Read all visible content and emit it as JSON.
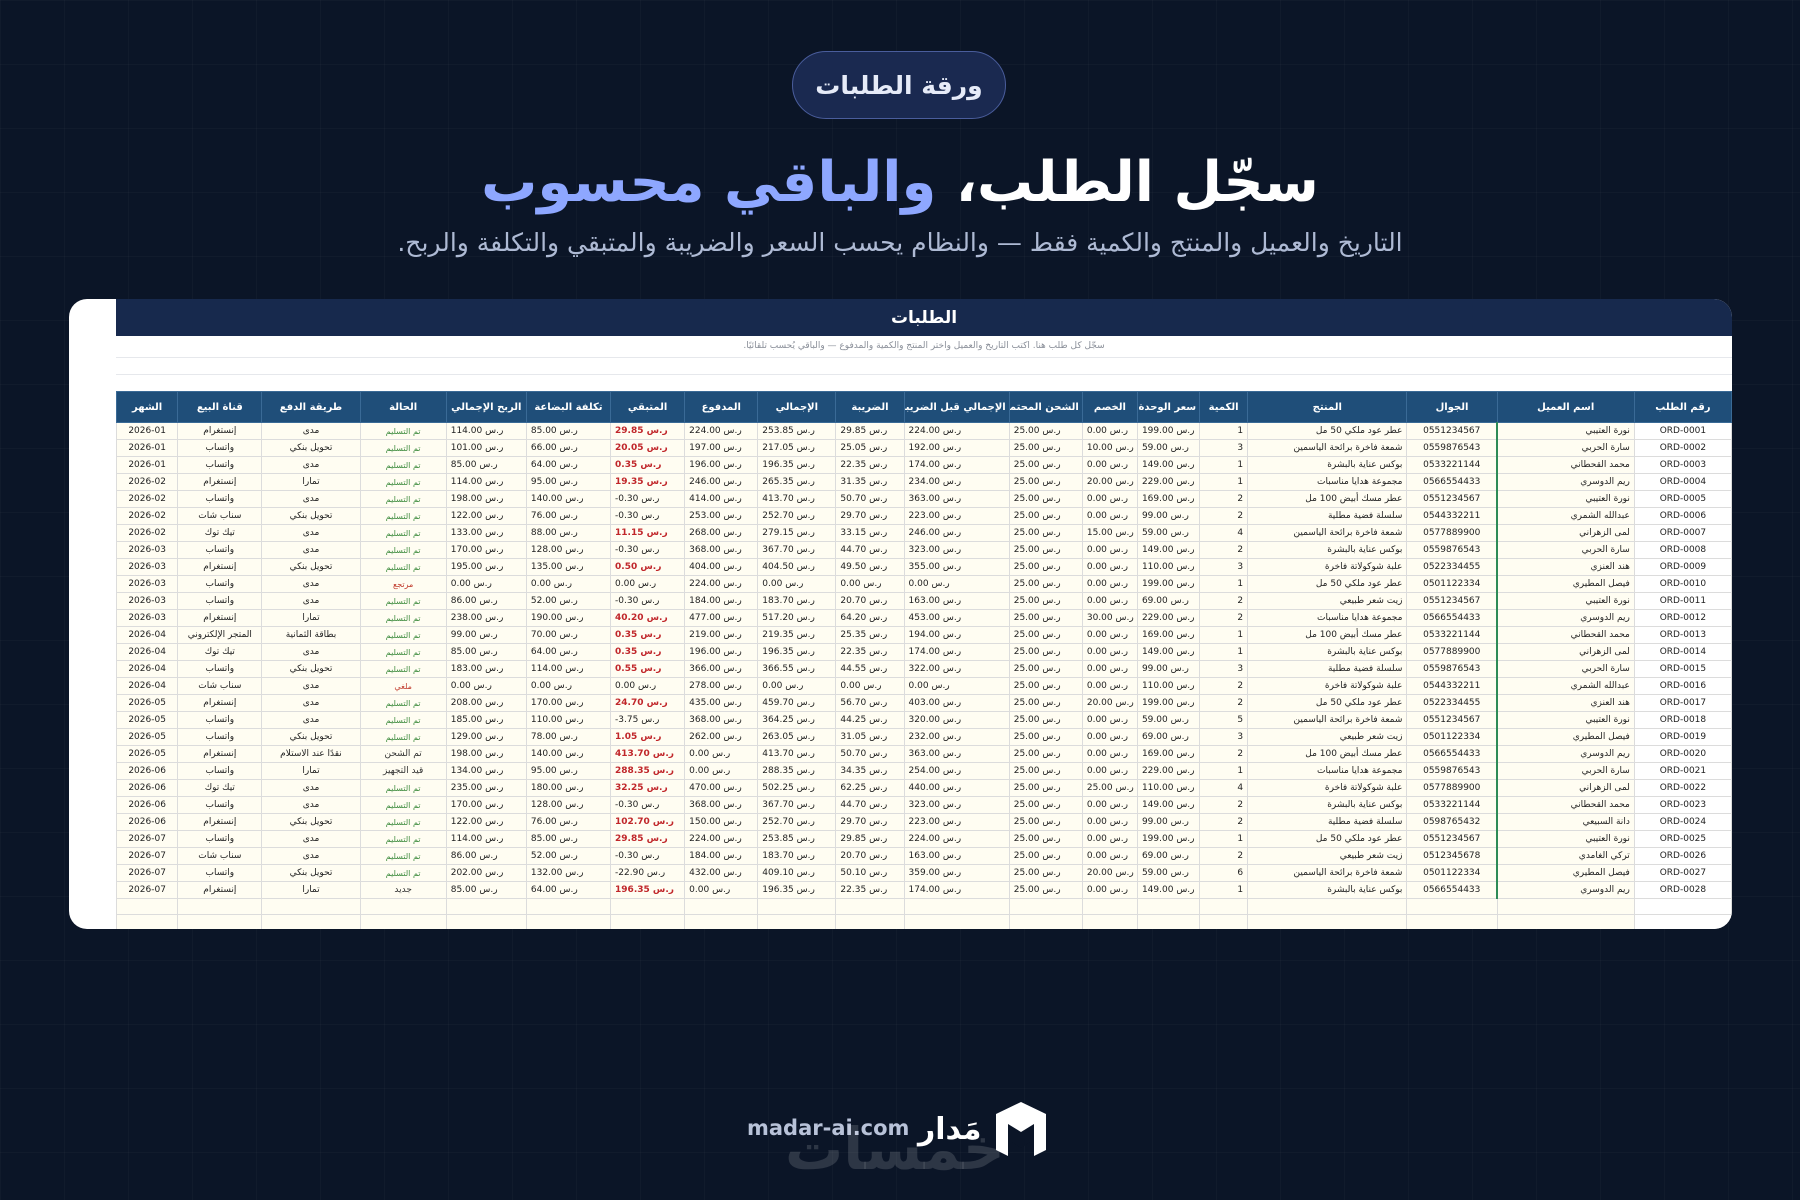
{
  "pill_label": "ورقة الطلبات",
  "headline": {
    "part1": "سجّل الطلب،",
    "accent": "والباقي محسوب"
  },
  "subtitle": "التاريخ والعميل والمنتج والكمية فقط — والنظام يحسب السعر والضريبة والمتبقي والتكلفة والربح.",
  "sheet": {
    "title": "الطلبات",
    "note": "سجّل كل طلب هنا. اكتب التاريخ والعميل واختر المنتج والكمية والمدفوع — والباقي يُحسب تلقائيًا.",
    "columns": [
      "رقم الطلب",
      "اسم العميل",
      "الجوال",
      "المنتج",
      "الكمية",
      "سعر الوحدة",
      "الخصم",
      "الشحن المحتمل",
      "الإجمالي قبل الضريبة",
      "الضريبة",
      "الإجمالي",
      "المدفوع",
      "المتبقي",
      "تكلفة البضاعة",
      "الربح الإجمالي",
      "الحالة",
      "طريقة الدفع",
      "قناة البيع",
      "الشهر"
    ],
    "rows": [
      [
        "ORD-0001",
        "نورة العتيبي",
        "0551234567",
        "عطر عود ملكي 50 مل",
        "1",
        "199.00 ر.س",
        "0.00 ر.س",
        "25.00 ر.س",
        "224.00 ر.س",
        "29.85 ر.س",
        "253.85 ر.س",
        "224.00 ر.س",
        "29.85 ر.س",
        "85.00 ر.س",
        "114.00 ر.س",
        "تم التسليم",
        "مدى",
        "إنستغرام",
        "2026-01"
      ],
      [
        "ORD-0002",
        "سارة الحربي",
        "0559876543",
        "شمعة فاخرة برائحة الياسمين",
        "3",
        "59.00 ر.س",
        "10.00 ر.س",
        "25.00 ر.س",
        "192.00 ر.س",
        "25.05 ر.س",
        "217.05 ر.س",
        "197.00 ر.س",
        "20.05 ر.س",
        "66.00 ر.س",
        "101.00 ر.س",
        "تم التسليم",
        "تحويل بنكي",
        "واتساب",
        "2026-01"
      ],
      [
        "ORD-0003",
        "محمد القحطاني",
        "0533221144",
        "بوكس عناية بالبشرة",
        "1",
        "149.00 ر.س",
        "0.00 ر.س",
        "25.00 ر.س",
        "174.00 ر.س",
        "22.35 ر.س",
        "196.35 ر.س",
        "196.00 ر.س",
        "0.35 ر.س",
        "64.00 ر.س",
        "85.00 ر.س",
        "تم التسليم",
        "مدى",
        "واتساب",
        "2026-01"
      ],
      [
        "ORD-0004",
        "ريم الدوسري",
        "0566554433",
        "مجموعة هدايا مناسبات",
        "1",
        "229.00 ر.س",
        "20.00 ر.س",
        "25.00 ر.س",
        "234.00 ر.س",
        "31.35 ر.س",
        "265.35 ر.س",
        "246.00 ر.س",
        "19.35 ر.س",
        "95.00 ر.س",
        "114.00 ر.س",
        "تم التسليم",
        "تمارا",
        "إنستغرام",
        "2026-02"
      ],
      [
        "ORD-0005",
        "نورة العتيبي",
        "0551234567",
        "عطر مسك أبيض 100 مل",
        "2",
        "169.00 ر.س",
        "0.00 ر.س",
        "25.00 ر.س",
        "363.00 ر.س",
        "50.70 ر.س",
        "413.70 ر.س",
        "414.00 ر.س",
        "-0.30 ر.س",
        "140.00 ر.س",
        "198.00 ر.س",
        "تم التسليم",
        "مدى",
        "واتساب",
        "2026-02"
      ],
      [
        "ORD-0006",
        "عبدالله الشمري",
        "0544332211",
        "سلسلة فضية مطلية",
        "2",
        "99.00 ر.س",
        "0.00 ر.س",
        "25.00 ر.س",
        "223.00 ر.س",
        "29.70 ر.س",
        "252.70 ر.س",
        "253.00 ر.س",
        "-0.30 ر.س",
        "76.00 ر.س",
        "122.00 ر.س",
        "تم التسليم",
        "تحويل بنكي",
        "سناب شات",
        "2026-02"
      ],
      [
        "ORD-0007",
        "لمى الزهراني",
        "0577889900",
        "شمعة فاخرة برائحة الياسمين",
        "4",
        "59.00 ر.س",
        "15.00 ر.س",
        "25.00 ر.س",
        "246.00 ر.س",
        "33.15 ر.س",
        "279.15 ر.س",
        "268.00 ر.س",
        "11.15 ر.س",
        "88.00 ر.س",
        "133.00 ر.س",
        "تم التسليم",
        "مدى",
        "تيك توك",
        "2026-02"
      ],
      [
        "ORD-0008",
        "سارة الحربي",
        "0559876543",
        "بوكس عناية بالبشرة",
        "2",
        "149.00 ر.س",
        "0.00 ر.س",
        "25.00 ر.س",
        "323.00 ر.س",
        "44.70 ر.س",
        "367.70 ر.س",
        "368.00 ر.س",
        "-0.30 ر.س",
        "128.00 ر.س",
        "170.00 ر.س",
        "تم التسليم",
        "مدى",
        "واتساب",
        "2026-03"
      ],
      [
        "ORD-0009",
        "هند العنزي",
        "0522334455",
        "علبة شوكولاتة فاخرة",
        "3",
        "110.00 ر.س",
        "0.00 ر.س",
        "25.00 ر.س",
        "355.00 ر.س",
        "49.50 ر.س",
        "404.50 ر.س",
        "404.00 ر.س",
        "0.50 ر.س",
        "135.00 ر.س",
        "195.00 ر.س",
        "تم التسليم",
        "تحويل بنكي",
        "إنستغرام",
        "2026-03"
      ],
      [
        "ORD-0010",
        "فيصل المطيري",
        "0501122334",
        "عطر عود ملكي 50 مل",
        "1",
        "199.00 ر.س",
        "0.00 ر.س",
        "25.00 ر.س",
        "0.00 ر.س",
        "0.00 ر.س",
        "0.00 ر.س",
        "224.00 ر.س",
        "0.00 ر.س",
        "0.00 ر.س",
        "0.00 ر.س",
        "مرتجع",
        "مدى",
        "واتساب",
        "2026-03"
      ],
      [
        "ORD-0011",
        "نورة العتيبي",
        "0551234567",
        "زيت شعر طبيعي",
        "2",
        "69.00 ر.س",
        "0.00 ر.س",
        "25.00 ر.س",
        "163.00 ر.س",
        "20.70 ر.س",
        "183.70 ر.س",
        "184.00 ر.س",
        "-0.30 ر.س",
        "52.00 ر.س",
        "86.00 ر.س",
        "تم التسليم",
        "مدى",
        "واتساب",
        "2026-03"
      ],
      [
        "ORD-0012",
        "ريم الدوسري",
        "0566554433",
        "مجموعة هدايا مناسبات",
        "2",
        "229.00 ر.س",
        "30.00 ر.س",
        "25.00 ر.س",
        "453.00 ر.س",
        "64.20 ر.س",
        "517.20 ر.س",
        "477.00 ر.س",
        "40.20 ر.س",
        "190.00 ر.س",
        "238.00 ر.س",
        "تم التسليم",
        "تمارا",
        "إنستغرام",
        "2026-03"
      ],
      [
        "ORD-0013",
        "محمد القحطاني",
        "0533221144",
        "عطر مسك أبيض 100 مل",
        "1",
        "169.00 ر.س",
        "0.00 ر.س",
        "25.00 ر.س",
        "194.00 ر.س",
        "25.35 ر.س",
        "219.35 ر.س",
        "219.00 ر.س",
        "0.35 ر.س",
        "70.00 ر.س",
        "99.00 ر.س",
        "تم التسليم",
        "بطاقة الثمانية",
        "المتجر الإلكتروني",
        "2026-04"
      ],
      [
        "ORD-0014",
        "لمى الزهراني",
        "0577889900",
        "بوكس عناية بالبشرة",
        "1",
        "149.00 ر.س",
        "0.00 ر.س",
        "25.00 ر.س",
        "174.00 ر.س",
        "22.35 ر.س",
        "196.35 ر.س",
        "196.00 ر.س",
        "0.35 ر.س",
        "64.00 ر.س",
        "85.00 ر.س",
        "تم التسليم",
        "مدى",
        "تيك توك",
        "2026-04"
      ],
      [
        "ORD-0015",
        "سارة الحربي",
        "0559876543",
        "سلسلة فضية مطلية",
        "3",
        "99.00 ر.س",
        "0.00 ر.س",
        "25.00 ر.س",
        "322.00 ر.س",
        "44.55 ر.س",
        "366.55 ر.س",
        "366.00 ر.س",
        "0.55 ر.س",
        "114.00 ر.س",
        "183.00 ر.س",
        "تم التسليم",
        "تحويل بنكي",
        "واتساب",
        "2026-04"
      ],
      [
        "ORD-0016",
        "عبدالله الشمري",
        "0544332211",
        "علبة شوكولاتة فاخرة",
        "2",
        "110.00 ر.س",
        "0.00 ر.س",
        "25.00 ر.س",
        "0.00 ر.س",
        "0.00 ر.س",
        "0.00 ر.س",
        "278.00 ر.س",
        "0.00 ر.س",
        "0.00 ر.س",
        "0.00 ر.س",
        "ملغي",
        "مدى",
        "سناب شات",
        "2026-04"
      ],
      [
        "ORD-0017",
        "هند العنزي",
        "0522334455",
        "عطر عود ملكي 50 مل",
        "2",
        "199.00 ر.س",
        "20.00 ر.س",
        "25.00 ر.س",
        "403.00 ر.س",
        "56.70 ر.س",
        "459.70 ر.س",
        "435.00 ر.س",
        "24.70 ر.س",
        "170.00 ر.س",
        "208.00 ر.س",
        "تم التسليم",
        "مدى",
        "إنستغرام",
        "2026-05"
      ],
      [
        "ORD-0018",
        "نورة العتيبي",
        "0551234567",
        "شمعة فاخرة برائحة الياسمين",
        "5",
        "59.00 ر.س",
        "0.00 ر.س",
        "25.00 ر.س",
        "320.00 ر.س",
        "44.25 ر.س",
        "364.25 ر.س",
        "368.00 ر.س",
        "-3.75 ر.س",
        "110.00 ر.س",
        "185.00 ر.س",
        "تم التسليم",
        "مدى",
        "واتساب",
        "2026-05"
      ],
      [
        "ORD-0019",
        "فيصل المطيري",
        "0501122334",
        "زيت شعر طبيعي",
        "3",
        "69.00 ر.س",
        "0.00 ر.س",
        "25.00 ر.س",
        "232.00 ر.س",
        "31.05 ر.س",
        "263.05 ر.س",
        "262.00 ر.س",
        "1.05 ر.س",
        "78.00 ر.س",
        "129.00 ر.س",
        "تم التسليم",
        "تحويل بنكي",
        "واتساب",
        "2026-05"
      ],
      [
        "ORD-0020",
        "ريم الدوسري",
        "0566554433",
        "عطر مسك أبيض 100 مل",
        "2",
        "169.00 ر.س",
        "0.00 ر.س",
        "25.00 ر.س",
        "363.00 ر.س",
        "50.70 ر.س",
        "413.70 ر.س",
        "0.00 ر.س",
        "413.70 ر.س",
        "140.00 ر.س",
        "198.00 ر.س",
        "تم الشحن",
        "نقدًا عند الاستلام",
        "إنستغرام",
        "2026-05"
      ],
      [
        "ORD-0021",
        "سارة الحربي",
        "0559876543",
        "مجموعة هدايا مناسبات",
        "1",
        "229.00 ر.س",
        "0.00 ر.س",
        "25.00 ر.س",
        "254.00 ر.س",
        "34.35 ر.س",
        "288.35 ر.س",
        "0.00 ر.س",
        "288.35 ر.س",
        "95.00 ر.س",
        "134.00 ر.س",
        "قيد التجهيز",
        "تمارا",
        "واتساب",
        "2026-06"
      ],
      [
        "ORD-0022",
        "لمى الزهراني",
        "0577889900",
        "علبة شوكولاتة فاخرة",
        "4",
        "110.00 ر.س",
        "25.00 ر.س",
        "25.00 ر.س",
        "440.00 ر.س",
        "62.25 ر.س",
        "502.25 ر.س",
        "470.00 ر.س",
        "32.25 ر.س",
        "180.00 ر.س",
        "235.00 ر.س",
        "تم التسليم",
        "مدى",
        "تيك توك",
        "2026-06"
      ],
      [
        "ORD-0023",
        "محمد القحطاني",
        "0533221144",
        "بوكس عناية بالبشرة",
        "2",
        "149.00 ر.س",
        "0.00 ر.س",
        "25.00 ر.س",
        "323.00 ر.س",
        "44.70 ر.س",
        "367.70 ر.س",
        "368.00 ر.س",
        "-0.30 ر.س",
        "128.00 ر.س",
        "170.00 ر.س",
        "تم التسليم",
        "مدى",
        "واتساب",
        "2026-06"
      ],
      [
        "ORD-0024",
        "دانة السبيعي",
        "0598765432",
        "سلسلة فضية مطلية",
        "2",
        "99.00 ر.س",
        "0.00 ر.س",
        "25.00 ر.س",
        "223.00 ر.س",
        "29.70 ر.س",
        "252.70 ر.س",
        "150.00 ر.س",
        "102.70 ر.س",
        "76.00 ر.س",
        "122.00 ر.س",
        "تم التسليم",
        "تحويل بنكي",
        "إنستغرام",
        "2026-06"
      ],
      [
        "ORD-0025",
        "نورة العتيبي",
        "0551234567",
        "عطر عود ملكي 50 مل",
        "1",
        "199.00 ر.س",
        "0.00 ر.س",
        "25.00 ر.س",
        "224.00 ر.س",
        "29.85 ر.س",
        "253.85 ر.س",
        "224.00 ر.س",
        "29.85 ر.س",
        "85.00 ر.س",
        "114.00 ر.س",
        "تم التسليم",
        "مدى",
        "واتساب",
        "2026-07"
      ],
      [
        "ORD-0026",
        "تركي الغامدي",
        "0512345678",
        "زيت شعر طبيعي",
        "2",
        "69.00 ر.س",
        "0.00 ر.س",
        "25.00 ر.س",
        "163.00 ر.س",
        "20.70 ر.س",
        "183.70 ر.س",
        "184.00 ر.س",
        "-0.30 ر.س",
        "52.00 ر.س",
        "86.00 ر.س",
        "تم التسليم",
        "مدى",
        "سناب شات",
        "2026-07"
      ],
      [
        "ORD-0027",
        "فيصل المطيري",
        "0501122334",
        "شمعة فاخرة برائحة الياسمين",
        "6",
        "59.00 ر.س",
        "20.00 ر.س",
        "25.00 ر.س",
        "359.00 ر.س",
        "50.10 ر.س",
        "409.10 ر.س",
        "432.00 ر.س",
        "-22.90 ر.س",
        "132.00 ر.س",
        "202.00 ر.س",
        "تم التسليم",
        "تحويل بنكي",
        "واتساب",
        "2026-07"
      ],
      [
        "ORD-0028",
        "ريم الدوسري",
        "0566554433",
        "بوكس عناية بالبشرة",
        "1",
        "149.00 ر.س",
        "0.00 ر.س",
        "25.00 ر.س",
        "174.00 ر.س",
        "22.35 ر.س",
        "196.35 ر.س",
        "0.00 ر.س",
        "196.35 ر.س",
        "64.00 ر.س",
        "85.00 ر.س",
        "جديد",
        "تمارا",
        "إنستغرام",
        "2026-07"
      ]
    ],
    "red_remaining_rows": [
      0,
      1,
      2,
      3,
      6,
      8,
      11,
      12,
      13,
      14,
      16,
      18,
      19,
      20,
      21,
      23,
      24,
      27
    ]
  },
  "footer": {
    "site": "madar-ai.com",
    "brand": "مَدار",
    "watermark": "خمسات"
  },
  "colors": {
    "background": "#0b1527",
    "accent": "#8ea7ff",
    "header": "#1f4e79",
    "title_bar": "#17294d"
  }
}
